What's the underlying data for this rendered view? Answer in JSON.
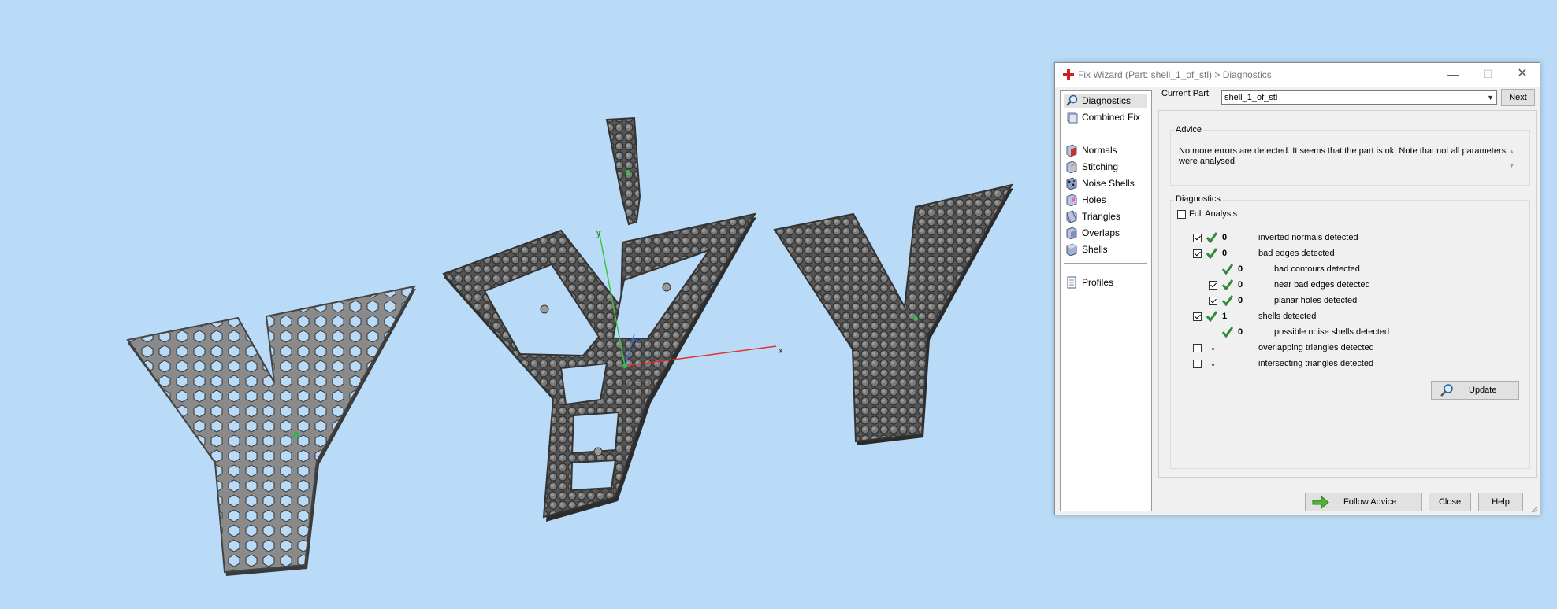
{
  "viewport": {
    "axis_labels": {
      "x": "x",
      "y": "y",
      "z": "z"
    }
  },
  "dialog": {
    "title": "Fix Wizard (Part: shell_1_of_stl) > Diagnostics",
    "controls": {
      "minimize": "—",
      "maximize": "☐",
      "close": "✕"
    },
    "nav": [
      {
        "label": "Diagnostics",
        "icon": "magnifier-icon"
      },
      {
        "label": "Combined Fix",
        "icon": "combined-fix-icon"
      },
      {
        "label": "Normals",
        "icon": "normals-cube-icon"
      },
      {
        "label": "Stitching",
        "icon": "stitching-cube-icon"
      },
      {
        "label": "Noise Shells",
        "icon": "noise-shells-icon"
      },
      {
        "label": "Holes",
        "icon": "holes-cube-icon"
      },
      {
        "label": "Triangles",
        "icon": "triangles-cube-icon"
      },
      {
        "label": "Overlaps",
        "icon": "overlaps-cube-icon"
      },
      {
        "label": "Shells",
        "icon": "shells-cube-icon"
      },
      {
        "label": "Profiles",
        "icon": "profiles-doc-icon"
      }
    ],
    "current_part_label": "Current Part:",
    "current_part_value": "shell_1_of_stl",
    "next_label": "Next",
    "advice_title": "Advice",
    "advice_text": "No more errors are detected. It seems that the part is ok. Note that not all parameters were analysed.",
    "diagnostics_title": "Diagnostics",
    "full_analysis_label": "Full Analysis",
    "rows": [
      {
        "count": "0",
        "text": "inverted normals detected"
      },
      {
        "count": "0",
        "text": "bad edges detected"
      },
      {
        "count": "0",
        "text": "bad contours detected"
      },
      {
        "count": "0",
        "text": "near bad edges detected"
      },
      {
        "count": "0",
        "text": "planar holes detected"
      },
      {
        "count": "1",
        "text": "shells detected"
      },
      {
        "count": "0",
        "text": "possible noise shells detected"
      },
      {
        "count": "",
        "text": "overlapping triangles detected"
      },
      {
        "count": "",
        "text": "intersecting triangles detected"
      }
    ],
    "update_label": "Update",
    "follow_advice_label": "Follow Advice",
    "close_label": "Close",
    "help_label": "Help",
    "colors": {
      "accent_green": "#2f8a3a",
      "window_bg": "#f0f0f0",
      "viewport_bg": "#b9dbf7"
    }
  }
}
